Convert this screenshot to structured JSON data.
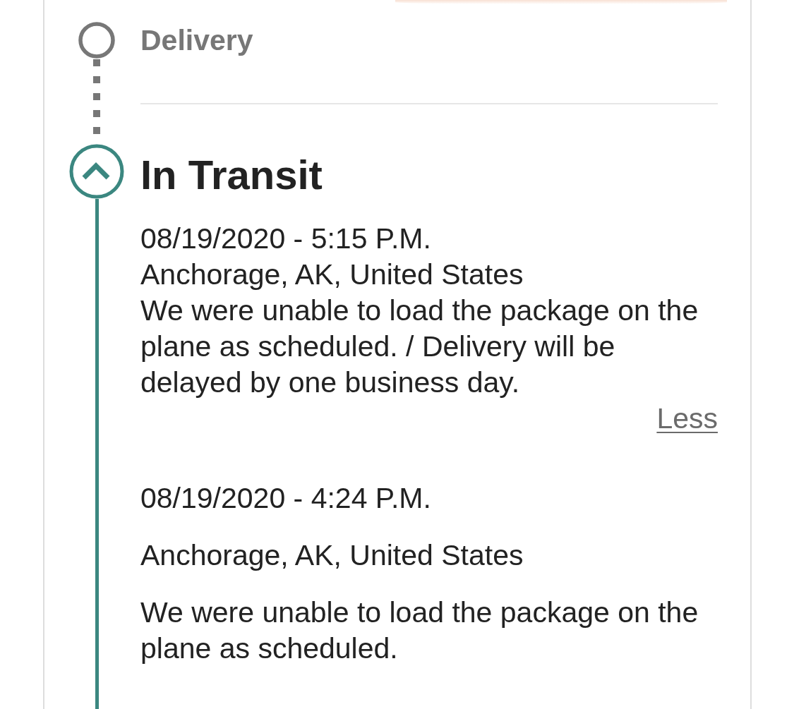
{
  "steps": [
    {
      "title": "Delivery",
      "kind": "pending"
    },
    {
      "title": "In Transit",
      "kind": "current",
      "expanded": true,
      "events": [
        {
          "kind": "compact",
          "date": "08/19/2020 - 5:15 P.M.",
          "location": "Anchorage, AK, United States",
          "description": "We were unable to load the package on the plane as scheduled. / Delivery will be delayed by one business day.",
          "toggle_link": "Less"
        },
        {
          "kind": "spaced",
          "date": "08/19/2020 - 4:24 P.M.",
          "location": "Anchorage, AK, United States",
          "description": "We were unable to load the package on the plane as scheduled."
        }
      ]
    }
  ]
}
